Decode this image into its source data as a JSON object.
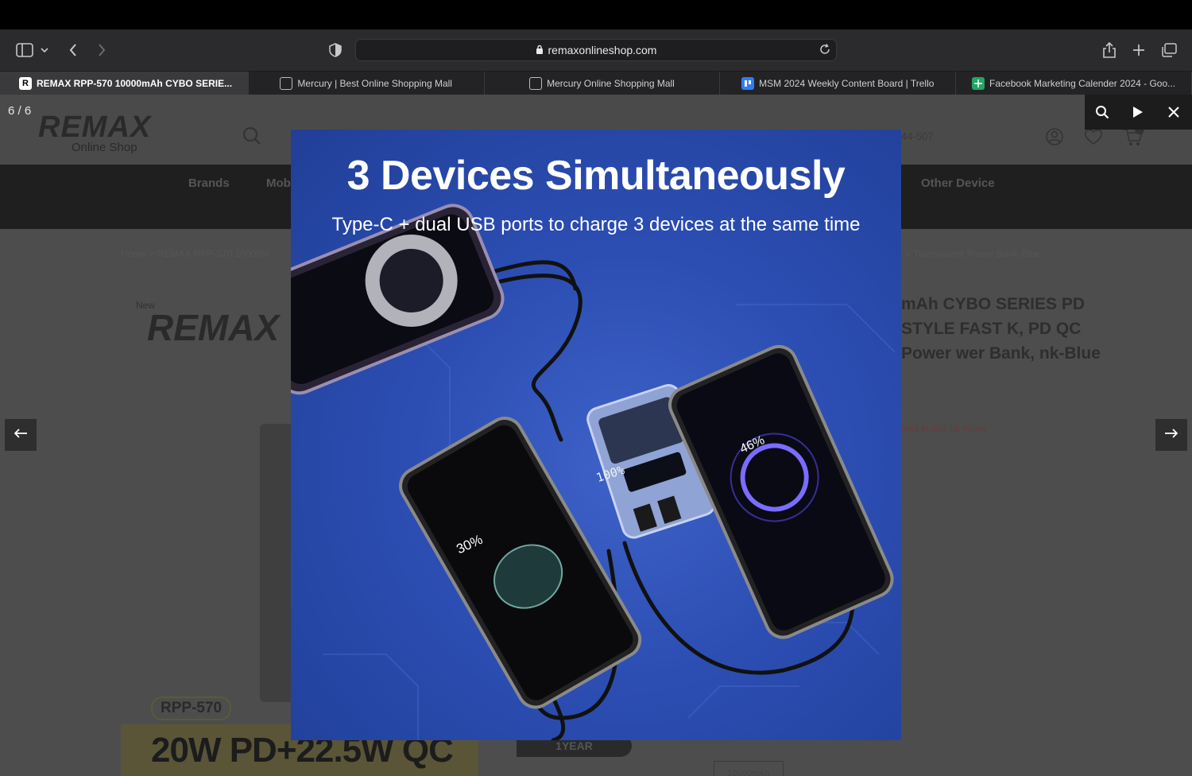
{
  "browser": {
    "url": "remaxonlineshop.com",
    "tabs": [
      {
        "title": "REMAX RPP-570 10000mAh CYBO SERIE...",
        "active": true
      },
      {
        "title": "Mercury | Best Online Shopping Mall",
        "active": false
      },
      {
        "title": "Mercury Online Shopping Mall",
        "active": false
      },
      {
        "title": "MSM 2024 Weekly Content Board | Trello",
        "active": false
      },
      {
        "title": "Facebook Marketing Calender 2024 - Goo...",
        "active": false
      }
    ]
  },
  "site": {
    "logo": "REMAX",
    "logo_sub": "Online Shop",
    "phone_fragment": "44-507",
    "nav": {
      "brands": "Brands",
      "mob": "Mob",
      "other": "Other Device"
    },
    "breadcrumb_left": "Home  >  REMAX RPP-570 10000m",
    "breadcrumb_right": "c Transparent Power Bank-Blue",
    "new_tag": "New",
    "product_title_fragment": "mAh CYBO SERIES PD STYLE FAST K, PD QC Power wer Bank, nk-Blue",
    "sold_text": "sold in last 18 hours",
    "model": "RPP-570",
    "spec_band": "20W PD+22.5W QC",
    "warranty": "1YEAR",
    "capacity": "10000mAh"
  },
  "lightbox": {
    "counter": "6 / 6",
    "headline": "3 Devices Simultaneously",
    "subheadline": "Type-C + dual USB ports to charge 3 devices at the same time",
    "left_phone_charge": "30%",
    "right_phone_charge": "46%",
    "bank_display": "100%"
  }
}
